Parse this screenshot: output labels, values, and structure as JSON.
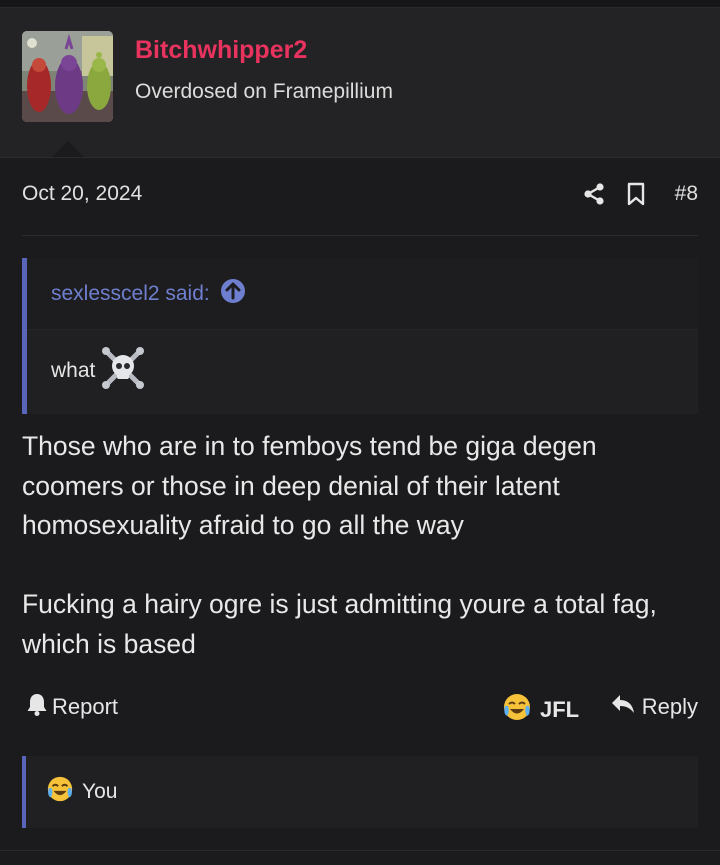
{
  "user": {
    "name": "Bitchwhipper2",
    "title": "Overdosed on Framepillium",
    "name_color": "#e8335f"
  },
  "post": {
    "date": "Oct 20, 2024",
    "number": "#8",
    "share_icon": "share-icon",
    "bookmark_icon": "bookmark-icon"
  },
  "quote": {
    "author_said": "sexlesscel2 said:",
    "up_icon": "arrow-up-circle-icon",
    "text": "what",
    "emoji": "skull-crossbones-emoji",
    "accent": "#5865b8"
  },
  "body": {
    "paragraph1": [
      "Those who are in to femboys tend be giga degen",
      "coomers or those in deep denial of their latent",
      "homosexuality afraid to go all the way"
    ],
    "paragraph2": [
      "Fucking a hairy ogre is just admitting youre a total fag,",
      "which is based"
    ]
  },
  "actions": {
    "report_label": "Report",
    "reaction_label": "JFL",
    "reply_label": "Reply"
  },
  "reactions": {
    "summary": "You",
    "emoji": "crying-laughing-emoji"
  }
}
